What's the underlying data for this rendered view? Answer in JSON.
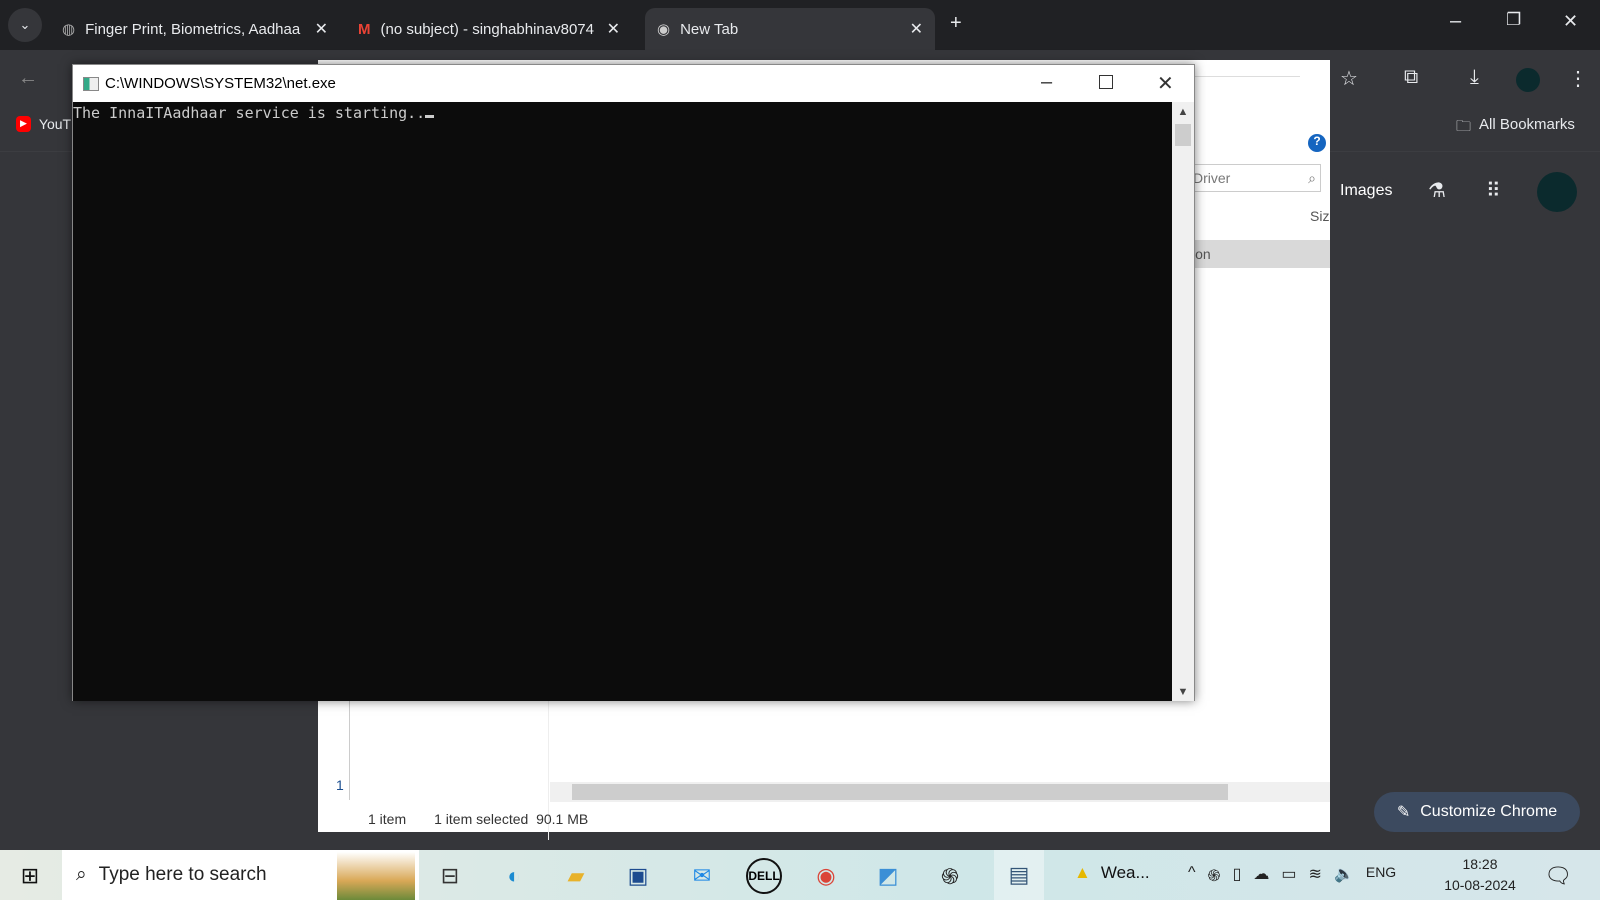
{
  "browser": {
    "tabs": [
      {
        "title": "Finger Print, Biometrics, Aadhaa",
        "icon": "globe-icon",
        "active": false
      },
      {
        "title": "(no subject) - singhabhinav8074",
        "icon": "gmail-icon",
        "active": false
      },
      {
        "title": "New Tab",
        "icon": "chrome-icon",
        "active": true
      }
    ],
    "bookmarks": {
      "youtube": "YouT",
      "all_bookmarks": "All Bookmarks"
    },
    "newtab": {
      "images_link": "Images",
      "customize": "Customize Chrome"
    }
  },
  "explorer": {
    "search_placeholder": "Driver",
    "column_size": "Siz",
    "column_desc": "ion",
    "left_number": "1",
    "status": {
      "items": "1 item",
      "selected": "1 item selected",
      "size": "90.1 MB"
    }
  },
  "console": {
    "title": "C:\\WINDOWS\\SYSTEM32\\net.exe",
    "output": "The InnaITAadhaar service is starting.."
  },
  "taskbar": {
    "search_placeholder": "Type here to search",
    "weather": "Wea...",
    "language": "ENG",
    "time": "18:28",
    "date": "10-08-2024"
  }
}
